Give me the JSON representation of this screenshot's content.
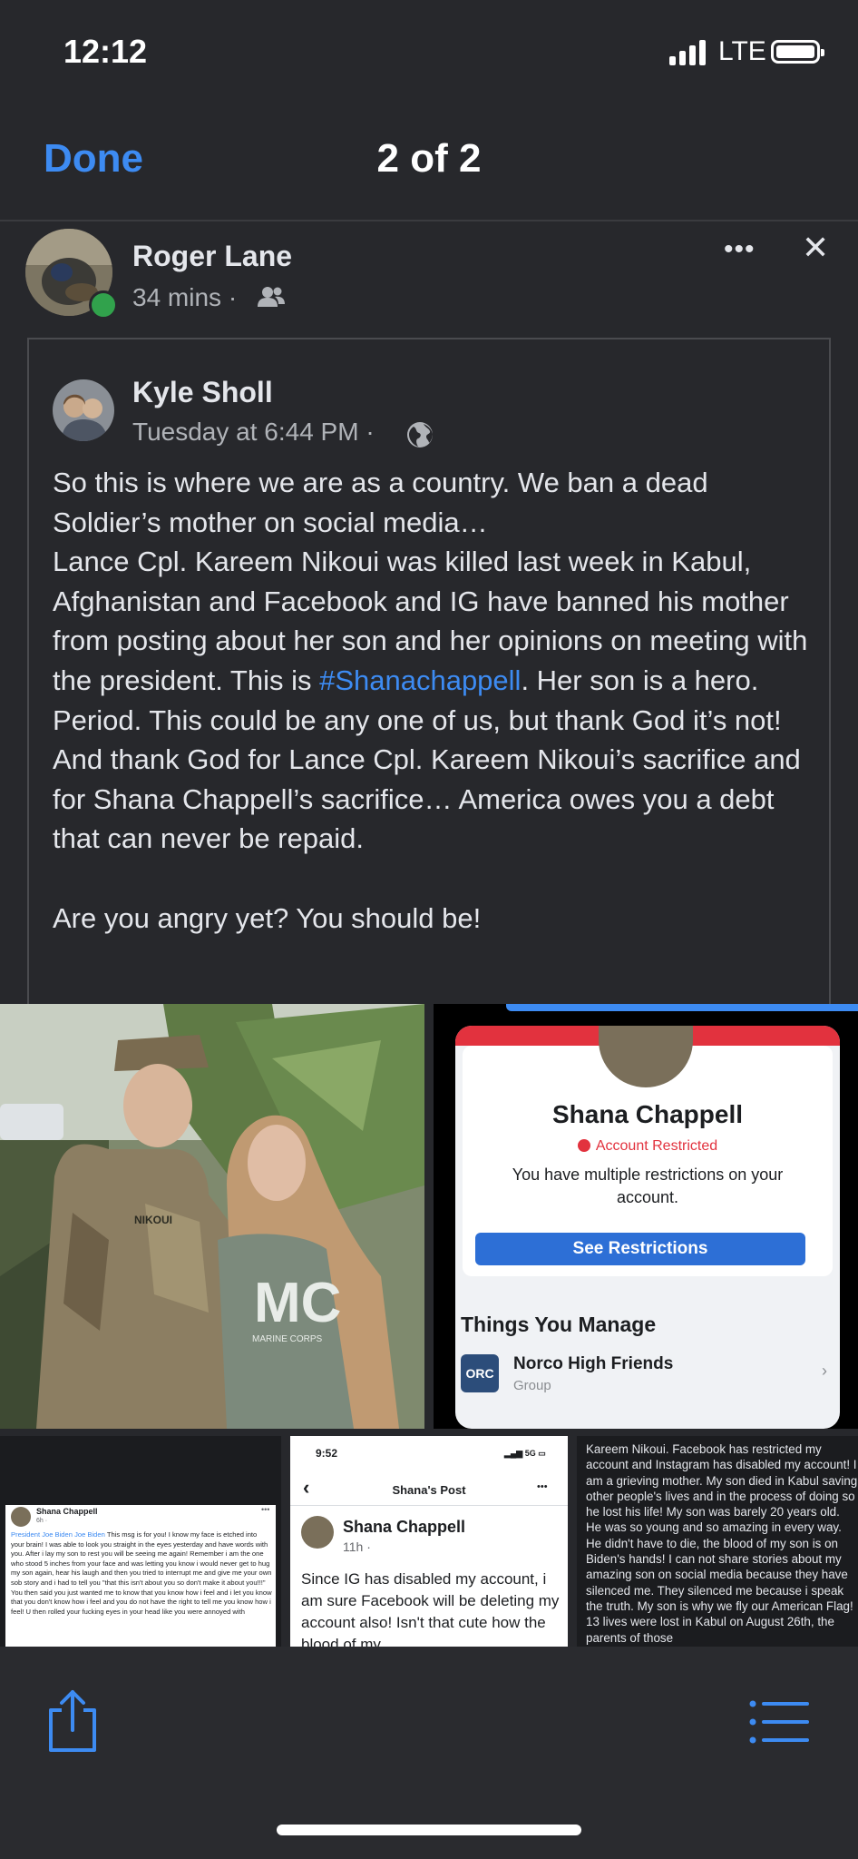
{
  "status_bar": {
    "time": "12:12",
    "network": "LTE"
  },
  "nav": {
    "done_label": "Done",
    "pager": "2 of 2"
  },
  "post": {
    "author": "Roger Lane",
    "time": "34 mins",
    "separator": "·",
    "more": "•••",
    "close": "✕"
  },
  "shared": {
    "author": "Kyle Sholl",
    "time": "Tuesday at 6:44 PM",
    "separator": "·",
    "text_before": "So this is where we are as a country. We ban a dead Soldier’s mother on social media…\nLance Cpl. Kareem Nikoui was killed last week in Kabul, Afghanistan and Facebook and IG have banned his mother from posting about her son and her opinions on meeting with the president. This is ",
    "hashtag": "#Shanachappell",
    "text_after": ". Her son is a hero. Period. This could be any one of us, but thank God it’s not! And thank God for Lance Cpl. Kareem Nikoui’s sacrifice and for Shana Chappell’s sacrifice… America owes you a debt that can never be repaid.\n\nAre you angry yet? You should be!"
  },
  "photo2": {
    "name": "Shana Chappell",
    "restricted": "Account Restricted",
    "message": "You have multiple restrictions on your account.",
    "button": "See Restrictions",
    "section": "Things You Manage",
    "group_name": "Norco High Friends",
    "group_type": "Group",
    "group_badge": "ORC"
  },
  "photo3": {
    "name": "Shana Chappell",
    "time": "6h · ",
    "tags": "President Joe Biden Joe Biden",
    "text": " This msg is for you! I know my face is etched into your brain! I was able to look you straight in the eyes yesterday and have words with you. After i lay my son to rest you will be seeing me again! Remember i am the one who stood 5 inches from your face and was letting you know i would never get to hug my son again, hear his laugh and then you tried to interrupt me and give me your own sob story and i had to tell you \"that this isn't about you so don't make it about you!!!\" You then said you just wanted me to know that you know how i feel and i let you know that you don't know how i feel and you do not have the right to tell me you know how i feel! U then rolled your fucking eyes in your head like you were annoyed with"
  },
  "photo4": {
    "time": "9:52",
    "net": "5G",
    "header": "Shana's Post",
    "more": "•••",
    "name": "Shana Chappell",
    "meta": "11h · ",
    "text": "Since IG has disabled my account, i am sure Facebook will be deleting my account also! Isn't that cute how the blood of my"
  },
  "photo5": {
    "text": "Kareem Nikoui. Facebook has restricted my account and Instagram has disabled my account! I am a grieving mother. My son died in Kabul saving other people's lives and in the process of doing so he lost his life! My son was barely 20 years old. He was so young and so amazing in every way.  He didn't have to die, the blood of my son is on Biden's hands! I can not share stories about my amazing son on social media because they have silenced me. They silenced me because i speak the truth. My son is why we fly our American Flag! 13 lives were lost in Kabul on August 26th, the parents of those"
  },
  "photo1": {
    "nametape": "NIKOUI",
    "shirt": "MC",
    "shirt_sub": "MARINE CORPS"
  },
  "colors": {
    "accent": "#3d8bf2",
    "background": "#27282c",
    "online": "#31a24c"
  },
  "toolbar": {
    "share_icon": "share-icon",
    "menu_icon": "list-menu-icon"
  }
}
